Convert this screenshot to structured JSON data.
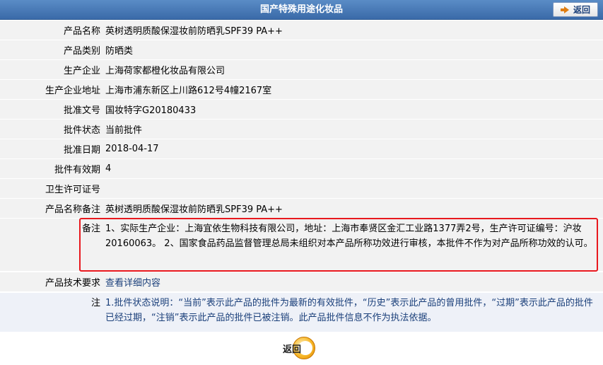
{
  "header": {
    "title": "国产特殊用途化妆品",
    "back_label": "返回"
  },
  "fields": {
    "product_name": {
      "label": "产品名称",
      "value": "英树透明质酸保湿妆前防晒乳SPF39 PA++"
    },
    "product_category": {
      "label": "产品类别",
      "value": "防晒类"
    },
    "manufacturer": {
      "label": "生产企业",
      "value": "上海荷家都橙化妆品有限公司"
    },
    "manufacturer_address": {
      "label": "生产企业地址",
      "value": "上海市浦东新区上川路612号4幢2167室"
    },
    "approval_number": {
      "label": "批准文号",
      "value": "国妆特字G20180433"
    },
    "approval_status": {
      "label": "批件状态",
      "value": "当前批件"
    },
    "approval_date": {
      "label": "批准日期",
      "value": "2018-04-17"
    },
    "validity_period": {
      "label": "批件有效期",
      "value": "4"
    },
    "health_license": {
      "label": "卫生许可证号",
      "value": ""
    },
    "product_name_note": {
      "label": "产品名称备注",
      "value": "英树透明质酸保湿妆前防晒乳SPF39 PA++"
    },
    "remarks": {
      "label": "备注",
      "value": "1、实际生产企业：上海宜依生物科技有限公司，地址：上海市奉贤区金汇工业路1377弄2号，生产许可证编号：沪妆20160063。 2、国家食品药品监督管理总局未组织对本产品所称功效进行审核，本批件不作为对产品所称功效的认可。"
    },
    "tech_requirements": {
      "label": "产品技术要求",
      "value": "查看详细内容"
    },
    "note": {
      "label": "注",
      "value": "1.批件状态说明：“当前”表示此产品的批件为最新的有效批件，“历史”表示此产品的曾用批件，“过期”表示此产品的批件已经过期，“注销”表示此产品的批件已被注销。此产品批件信息不作为执法依据。"
    }
  },
  "footer": {
    "back_label": "返回"
  },
  "colors": {
    "title_bar": "#3a6aa8",
    "row_bg": "#f2f2f2",
    "highlight_border": "#e8181e",
    "link": "#1a3f7a"
  }
}
